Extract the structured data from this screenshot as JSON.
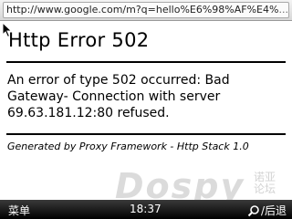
{
  "url_bar": {
    "url": "http://www.google.com/m?q=hello%E6%98%AF%E4%",
    "overflow": "..."
  },
  "page": {
    "title": "Http Error 502",
    "message": "An error of type 502 occurred: Bad Gateway- Connection with server 69.63.181.12:80 refused.",
    "footer": "Generated by Proxy Framework - Http Stack 1.0"
  },
  "watermark": {
    "text": "Dospy",
    "cjk": "诺亚 论坛"
  },
  "softkeys": {
    "left": "菜单",
    "clock": "18:37",
    "right": "/后退",
    "right_icon": "search-icon"
  }
}
